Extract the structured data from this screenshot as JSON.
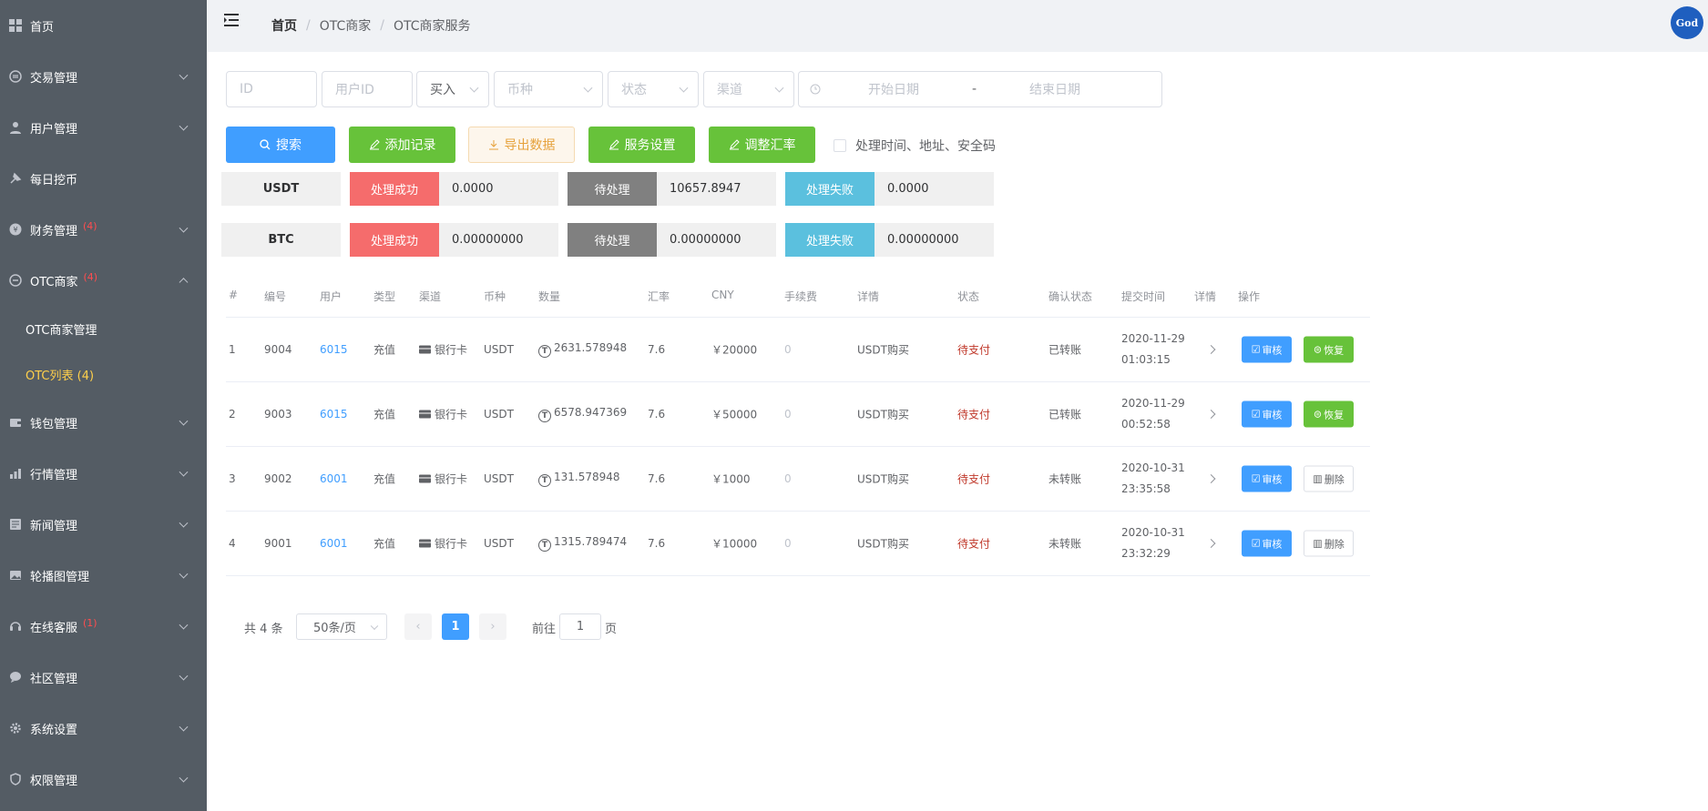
{
  "sidebar": {
    "items": [
      {
        "label": "首页",
        "icon": "grid-icon",
        "badge": ""
      },
      {
        "label": "交易管理",
        "icon": "exchange-icon",
        "badge": ""
      },
      {
        "label": "用户管理",
        "icon": "user-icon",
        "badge": ""
      },
      {
        "label": "每日挖币",
        "icon": "mining-icon",
        "badge": ""
      },
      {
        "label": "财务管理",
        "icon": "coin-icon",
        "badge": "(4)"
      },
      {
        "label": "OTC商家",
        "icon": "otc-icon",
        "badge": "(4)"
      },
      {
        "label": "钱包管理",
        "icon": "wallet-icon",
        "badge": ""
      },
      {
        "label": "行情管理",
        "icon": "chart-icon",
        "badge": ""
      },
      {
        "label": "新闻管理",
        "icon": "news-icon",
        "badge": ""
      },
      {
        "label": "轮播图管理",
        "icon": "carousel-icon",
        "badge": ""
      },
      {
        "label": "在线客服",
        "icon": "headset-icon",
        "badge": "(1)"
      },
      {
        "label": "社区管理",
        "icon": "chat-icon",
        "badge": ""
      },
      {
        "label": "系统设置",
        "icon": "gear-icon",
        "badge": ""
      },
      {
        "label": "权限管理",
        "icon": "shield-icon",
        "badge": ""
      }
    ],
    "sub_items": [
      {
        "label": "OTC商家管理"
      },
      {
        "label": "OTC列表 (4)"
      }
    ]
  },
  "header": {
    "breadcrumb": [
      "首页",
      "OTC商家",
      "OTC商家服务"
    ],
    "avatar_text": "God"
  },
  "filters": {
    "id_placeholder": "ID",
    "user_id_placeholder": "用户ID",
    "direction_value": "买入",
    "currency_placeholder": "币种",
    "status_placeholder": "状态",
    "channel_placeholder": "渠道",
    "start_date_placeholder": "开始日期",
    "date_separator": "-",
    "end_date_placeholder": "结束日期"
  },
  "actions": {
    "search": "搜索",
    "add_record": "添加记录",
    "export": "导出数据",
    "service_settings": "服务设置",
    "adjust_rate": "调整汇率",
    "checkbox_label": "处理时间、地址、安全码"
  },
  "stats": [
    {
      "coin": "USDT",
      "success_label": "处理成功",
      "success": "0.0000",
      "pending_label": "待处理",
      "pending": "10657.8947",
      "failed_label": "处理失败",
      "failed": "0.0000"
    },
    {
      "coin": "BTC",
      "success_label": "处理成功",
      "success": "0.00000000",
      "pending_label": "待处理",
      "pending": "0.00000000",
      "failed_label": "处理失败",
      "failed": "0.00000000"
    }
  ],
  "table": {
    "headers": [
      "#",
      "编号",
      "用户",
      "类型",
      "渠道",
      "币种",
      "数量",
      "汇率",
      "CNY",
      "手续费",
      "详情",
      "状态",
      "确认状态",
      "提交时间",
      "详情",
      "操作"
    ],
    "rows": [
      {
        "idx": "1",
        "no": "9004",
        "user": "6015",
        "type": "充值",
        "channel": "银行卡",
        "coin": "USDT",
        "amount": "2631.578948",
        "rate": "7.6",
        "cny": "￥20000",
        "fee": "0",
        "detail": "USDT购买",
        "status": "待支付",
        "confirm": "已转账",
        "date": "2020-11-29",
        "time": "01:03:15",
        "btn1": "审核",
        "btn2": "恢复",
        "btn2_type": "green"
      },
      {
        "idx": "2",
        "no": "9003",
        "user": "6015",
        "type": "充值",
        "channel": "银行卡",
        "coin": "USDT",
        "amount": "6578.947369",
        "rate": "7.6",
        "cny": "￥50000",
        "fee": "0",
        "detail": "USDT购买",
        "status": "待支付",
        "confirm": "已转账",
        "date": "2020-11-29",
        "time": "00:52:58",
        "btn1": "审核",
        "btn2": "恢复",
        "btn2_type": "green"
      },
      {
        "idx": "3",
        "no": "9002",
        "user": "6001",
        "type": "充值",
        "channel": "银行卡",
        "coin": "USDT",
        "amount": "131.578948",
        "rate": "7.6",
        "cny": "￥1000",
        "fee": "0",
        "detail": "USDT购买",
        "status": "待支付",
        "confirm": "未转账",
        "date": "2020-10-31",
        "time": "23:35:58",
        "btn1": "审核",
        "btn2": "删除",
        "btn2_type": "plain"
      },
      {
        "idx": "4",
        "no": "9001",
        "user": "6001",
        "type": "充值",
        "channel": "银行卡",
        "coin": "USDT",
        "amount": "1315.789474",
        "rate": "7.6",
        "cny": "￥10000",
        "fee": "0",
        "detail": "USDT购买",
        "status": "待支付",
        "confirm": "未转账",
        "date": "2020-10-31",
        "time": "23:32:29",
        "btn1": "审核",
        "btn2": "删除",
        "btn2_type": "plain"
      }
    ]
  },
  "pagination": {
    "total": "共 4 条",
    "page_size": "50条/页",
    "current_page": "1",
    "goto_prefix": "前往",
    "goto_value": "1",
    "goto_suffix": "页"
  },
  "colors": {
    "sidebar_bg": "#545c64",
    "active_sub": "#ffd04b",
    "primary": "#409eff",
    "success": "#67c23a",
    "danger": "#f56c6c",
    "info": "#5bc0de",
    "badge": "#ff4d4f"
  }
}
